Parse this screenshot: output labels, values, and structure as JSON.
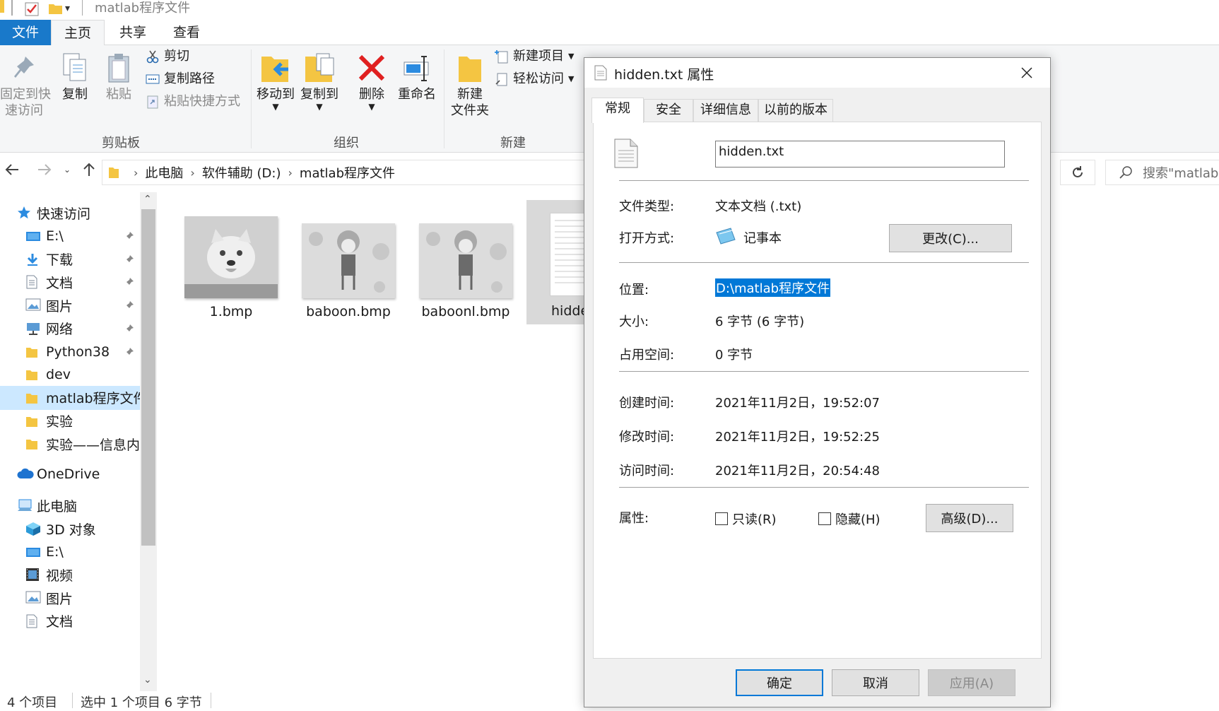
{
  "window": {
    "title": "matlab程序文件"
  },
  "ribbon_tabs": [
    "文件",
    "主页",
    "共享",
    "查看"
  ],
  "ribbon": {
    "clipboard": {
      "pin_label_1": "固定到快",
      "pin_label_2": "速访问",
      "copy_label": "复制",
      "paste_label": "粘贴",
      "cut_label": "剪切",
      "copy_path_label": "复制路径",
      "paste_shortcut_label": "粘贴快捷方式",
      "group_label": "剪贴板"
    },
    "organize": {
      "move_to_label": "移动到",
      "copy_to_label": "复制到",
      "delete_label": "删除",
      "rename_label": "重命名",
      "group_label": "组织"
    },
    "new": {
      "new_folder_label_1": "新建",
      "new_folder_label_2": "文件夹",
      "new_item_label": "新建项目",
      "easy_access_label": "轻松访问",
      "group_label": "新建"
    }
  },
  "address": {
    "crumbs": [
      "此电脑",
      "软件辅助 (D:)",
      "matlab程序文件"
    ]
  },
  "search": {
    "placeholder": "搜索\"matlab"
  },
  "nav_pane": {
    "quick_access": "快速访问",
    "items": [
      {
        "label": "E:\\",
        "icon": "drive-icon",
        "pinned": true
      },
      {
        "label": "下载",
        "icon": "download-icon",
        "pinned": true
      },
      {
        "label": "文档",
        "icon": "document-icon",
        "pinned": true
      },
      {
        "label": "图片",
        "icon": "pictures-icon",
        "pinned": true
      },
      {
        "label": "网络",
        "icon": "network-icon",
        "pinned": true
      },
      {
        "label": "Python38",
        "icon": "folder-icon",
        "pinned": true
      },
      {
        "label": "dev",
        "icon": "folder-icon",
        "pinned": false
      },
      {
        "label": "matlab程序文件",
        "icon": "folder-icon",
        "pinned": false
      },
      {
        "label": "实验",
        "icon": "folder-icon",
        "pinned": false
      },
      {
        "label": "实验——信息内:",
        "icon": "folder-icon",
        "pinned": false
      }
    ],
    "onedrive": "OneDrive",
    "this_pc": "此电脑",
    "pc_items": [
      {
        "label": "3D 对象",
        "icon": "3d-objects-icon"
      },
      {
        "label": "E:\\",
        "icon": "drive-icon"
      },
      {
        "label": "视频",
        "icon": "video-icon"
      },
      {
        "label": "图片",
        "icon": "pictures-icon"
      },
      {
        "label": "文档",
        "icon": "document-icon"
      }
    ]
  },
  "files": [
    {
      "name": "1.bmp",
      "thumb": "dog-image"
    },
    {
      "name": "baboon.bmp",
      "thumb": "girl-image"
    },
    {
      "name": "baboonl.bmp",
      "thumb": "girl-image"
    },
    {
      "name": "hidde",
      "thumb": "text-file"
    }
  ],
  "status": {
    "count": "4 个项目",
    "selected": "选中 1 个项目  6 字节"
  },
  "dialog": {
    "title": "hidden.txt 属性",
    "tabs": [
      "常规",
      "安全",
      "详细信息",
      "以前的版本"
    ],
    "filename": "hidden.txt",
    "type_label": "文件类型:",
    "type_value": "文本文档 (.txt)",
    "open_with_label": "打开方式:",
    "open_with_value": "记事本",
    "change_button": "更改(C)...",
    "location_label": "位置:",
    "location_value": "D:\\matlab程序文件",
    "size_label": "大小:",
    "size_value": "6 字节 (6 字节)",
    "size_on_disk_label": "占用空间:",
    "size_on_disk_value": "0 字节",
    "created_label": "创建时间:",
    "created_value": "2021年11月2日，19:52:07",
    "modified_label": "修改时间:",
    "modified_value": "2021年11月2日，19:52:25",
    "accessed_label": "访问时间:",
    "accessed_value": "2021年11月2日，20:54:48",
    "attributes_label": "属性:",
    "readonly_label": "只读(R)",
    "readonly_checked": false,
    "hidden_label": "隐藏(H)",
    "hidden_checked": false,
    "advanced_button": "高级(D)...",
    "ok_button": "确定",
    "cancel_button": "取消",
    "apply_button": "应用(A)"
  },
  "colors": {
    "accent": "#1979ca",
    "selection": "#cce8ff",
    "highlight": "#0078d7"
  }
}
